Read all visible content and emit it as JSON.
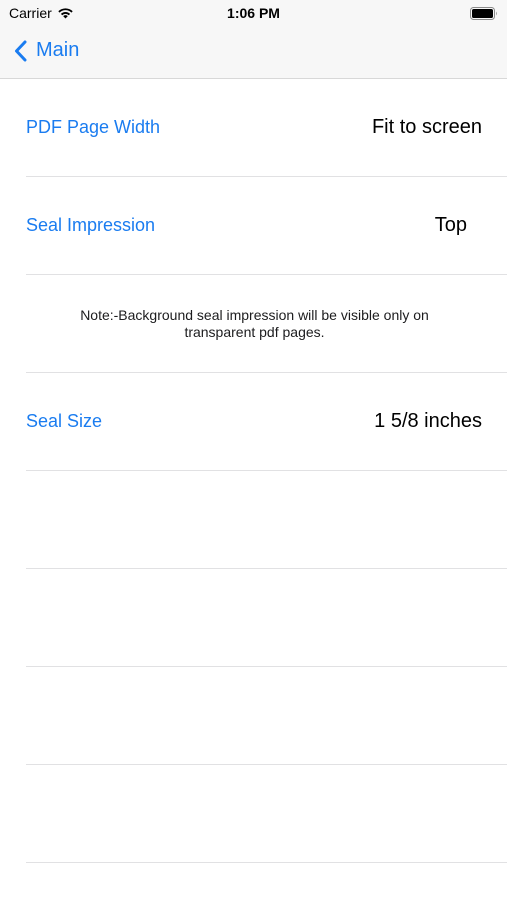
{
  "status_bar": {
    "carrier": "Carrier",
    "time": "1:06 PM",
    "wifi_icon": "wifi-icon",
    "battery_icon": "battery-icon"
  },
  "nav": {
    "back_label": "Main",
    "back_icon": "chevron-left-icon",
    "tint_color": "#1a7cf0"
  },
  "settings": {
    "pdf_page_width": {
      "label": "PDF Page Width",
      "value": "Fit to screen"
    },
    "seal_impression": {
      "label": "Seal Impression",
      "value": "Top"
    },
    "note": "Note:-Background seal impression will be visible only on transparent pdf pages.",
    "seal_size": {
      "label": "Seal Size",
      "value": "1 5/8 inches"
    }
  }
}
